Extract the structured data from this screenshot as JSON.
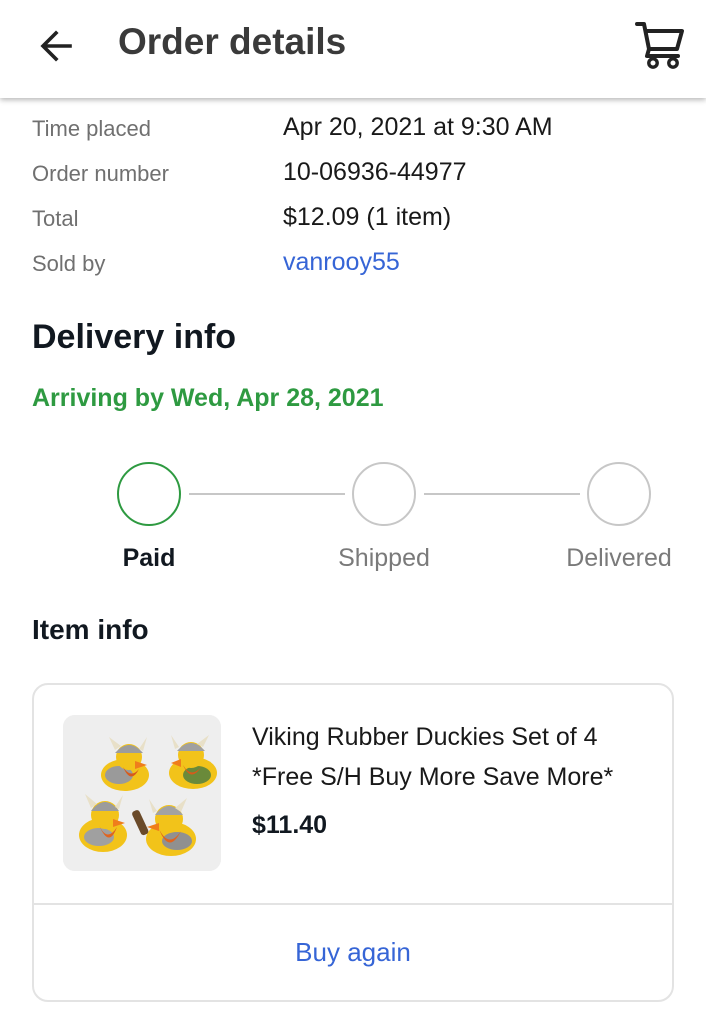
{
  "header": {
    "back_icon": "arrow-left-icon",
    "title": "Order details",
    "cart_icon": "shopping-cart-icon"
  },
  "summary": {
    "rows": [
      {
        "label": "Time placed",
        "value": "Apr 20, 2021 at 9:30 AM"
      },
      {
        "label": "Order number",
        "value": "10-06936-44977"
      },
      {
        "label": "Total",
        "value": "$12.09 (1 item)"
      },
      {
        "label": "Sold by",
        "value": "vanrooy55"
      }
    ]
  },
  "delivery": {
    "title": "Delivery info",
    "arrival": "Arriving by Wed, Apr 28, 2021",
    "steps": [
      {
        "label": "Paid",
        "state": "current"
      },
      {
        "label": "Shipped",
        "state": "pending"
      },
      {
        "label": "Delivered",
        "state": "pending"
      }
    ]
  },
  "item": {
    "section_title": "Item info",
    "title": "Viking Rubber Duckies Set of 4 *Free S/H Buy More Save More*",
    "price": "$11.40",
    "image_icon": "rubber-duck-product-image",
    "buy_again_label": "Buy again"
  },
  "colors": {
    "accent_green": "#2e9a41",
    "link_blue": "#3665d6",
    "text_primary": "#111820",
    "text_secondary": "#707070",
    "inactive_gray": "#c7c7c7"
  }
}
